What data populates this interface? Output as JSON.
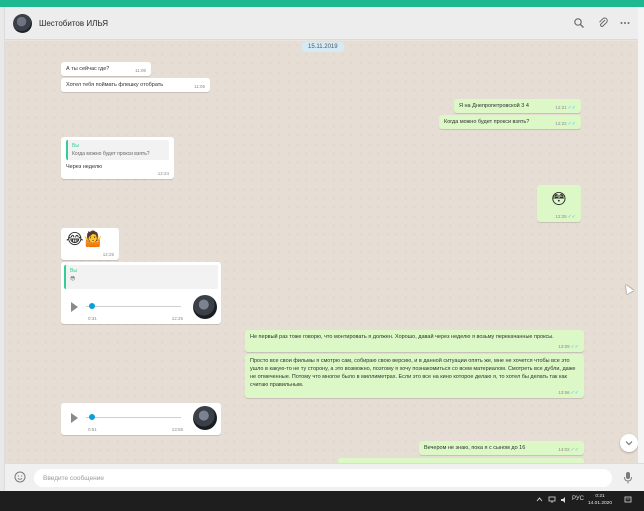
{
  "colors": {
    "accent_top": "#1fb890",
    "bubble_out": "#dcf8c6",
    "bubble_in": "#ffffff",
    "chat_bg": "#e6ddd4",
    "quote_bar": "#35cd96",
    "voice_knob": "#09a0d8",
    "read_ticks": "#4fc3f7"
  },
  "header": {
    "contact_name": "Шестобитов ИЛЬЯ",
    "icons": [
      "search-icon",
      "paperclip-icon",
      "more-icon"
    ]
  },
  "chat": {
    "date_label": "15.11.2019",
    "messages": [
      {
        "dir": "in",
        "text": "А ты сейчас где?",
        "time": "11:06"
      },
      {
        "dir": "in",
        "text": "Хотел тебя поймать флешку отобрать",
        "time": "11:06"
      },
      {
        "dir": "out",
        "text": "Я на Днепропетровской 3 4",
        "time": "12:21"
      },
      {
        "dir": "out",
        "text": "Когда можно будет прокси взять?",
        "time": "12:22"
      },
      {
        "dir": "in",
        "quote_author": "Вы",
        "quote_text": "Когда можно будет прокси взять?",
        "text": "Через неделю",
        "time": "12:24"
      },
      {
        "dir": "out",
        "emoji": "😳",
        "time": "12:25"
      },
      {
        "dir": "in",
        "emoji": "😂🤷",
        "time": "12:25"
      },
      {
        "dir": "in",
        "quote_author": "Вы",
        "quote_emoji": "😳",
        "voice_duration": "0:31",
        "time": "12:25"
      },
      {
        "dir": "out",
        "text": "Не первый раз тоже говорю, что монтировать я должен. Хорошо, давай через неделю я возьму перекачанные проксы.",
        "time": "13:09"
      },
      {
        "dir": "out",
        "text": "Просто все свои фильмы я смотрю сам, собираю свою версию, и в данной ситуации опять же, мне не хочется чтобы все это ушло в какую-то не ту сторону, а это возможно, поэтому я хочу познакомиться со всем материалом. Смотреть все дубли, даже не отмеченные. Потому что многое было в миллиметрах. Если это все на кино которое делаю я, то хотел бы делать так как считаю правильным.",
        "time": "13:56"
      },
      {
        "dir": "in",
        "voice_duration": "0:51",
        "time": "13:55"
      },
      {
        "dir": "out",
        "text": "Вечером не знаю, пока я с сыном до 16",
        "time": "14:02"
      }
    ]
  },
  "footer": {
    "placeholder": "Введите сообщение",
    "icons": [
      "emoji-icon",
      "microphone-icon"
    ]
  },
  "taskbar": {
    "lang": "РУС",
    "time": "0:21",
    "date": "14.01.2020"
  }
}
